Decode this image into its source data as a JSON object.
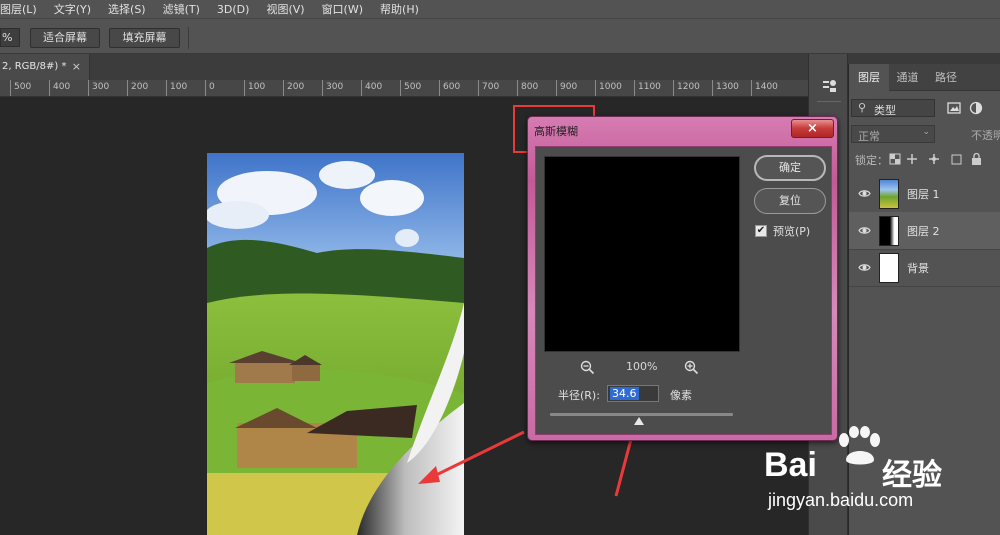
{
  "menu": [
    "图层(L)",
    "文字(Y)",
    "选择(S)",
    "滤镜(T)",
    "3D(D)",
    "视图(V)",
    "窗口(W)",
    "帮助(H)"
  ],
  "options": {
    "zoom_fragment": "%",
    "fit_screen": "适合屏幕",
    "fill_screen": "填充屏幕"
  },
  "document_tab": {
    "label": "2, RGB/8#) *",
    "close": "×"
  },
  "ruler_ticks": [
    "500",
    "400",
    "300",
    "200",
    "100",
    "0",
    "100",
    "200",
    "300",
    "400",
    "500",
    "600",
    "700",
    "800",
    "900",
    "1000",
    "1100",
    "1200",
    "1300",
    "1400"
  ],
  "panel": {
    "tabs": [
      "图层",
      "通道",
      "路径"
    ],
    "filter_label": "类型",
    "blend_mode": "正常",
    "opacity_label": "不透明",
    "lock_label": "锁定：",
    "layers": [
      {
        "name": "图层 1",
        "selected": false
      },
      {
        "name": "图层 2",
        "selected": true
      },
      {
        "name": "背景",
        "selected": false
      }
    ]
  },
  "dialog": {
    "title": "高斯模糊",
    "close": "×",
    "ok": "确定",
    "reset": "复位",
    "preview_label": "预览(P)",
    "preview_checked": true,
    "zoom": "100%",
    "radius_label": "半径(R):",
    "radius_value": "34.6",
    "radius_unit": "像素"
  },
  "watermark": {
    "brand": "Bai",
    "brand_cn": "经验",
    "url": "jingyan.baidu.com"
  },
  "colors": {
    "dialog_frame": "#c35a98",
    "highlight": "#e83a3a",
    "selection_blue": "#2f6bd4"
  }
}
